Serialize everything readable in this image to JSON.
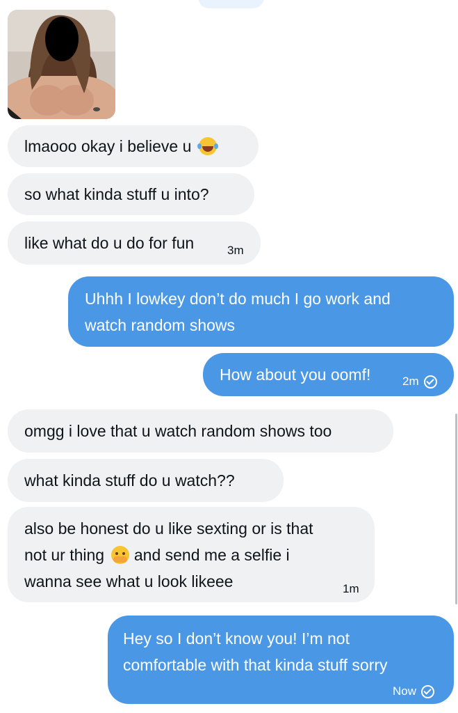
{
  "thread": {
    "messages": [
      {
        "direction": "in",
        "text": "lmaooo okay i believe u",
        "emoji": "laughing-emoji"
      },
      {
        "direction": "in",
        "text": "so what kinda stuff u into?"
      },
      {
        "direction": "in",
        "text": "like what do u do for fun",
        "time": "3m"
      },
      {
        "direction": "out",
        "lines": [
          "Uhhh I lowkey don’t do much I go work and",
          "watch random shows"
        ]
      },
      {
        "direction": "out",
        "text": "How about you oomf!",
        "time": "2m",
        "status": "seen"
      },
      {
        "direction": "in",
        "text": "omgg i love that u watch random shows too"
      },
      {
        "direction": "in",
        "text": "what kinda stuff do u watch??"
      },
      {
        "direction": "in",
        "lines": [
          "also be honest do u like sexting or is that",
          "not ur thing",
          "and send me a selfie i",
          "wanna see what u look likeee"
        ],
        "emoji": "shy-emoji",
        "time": "1m"
      },
      {
        "direction": "out",
        "lines": [
          "Hey so I don’t know you! I’m not",
          "comfortable with that kinda stuff sorry"
        ],
        "time": "Now",
        "status": "seen"
      }
    ]
  },
  "colors": {
    "incoming_bubble": "#eff1f3",
    "outgoing_bubble": "#4a97e6"
  },
  "icons": [
    "check-circle-icon",
    "laughing-emoji",
    "shy-emoji"
  ]
}
